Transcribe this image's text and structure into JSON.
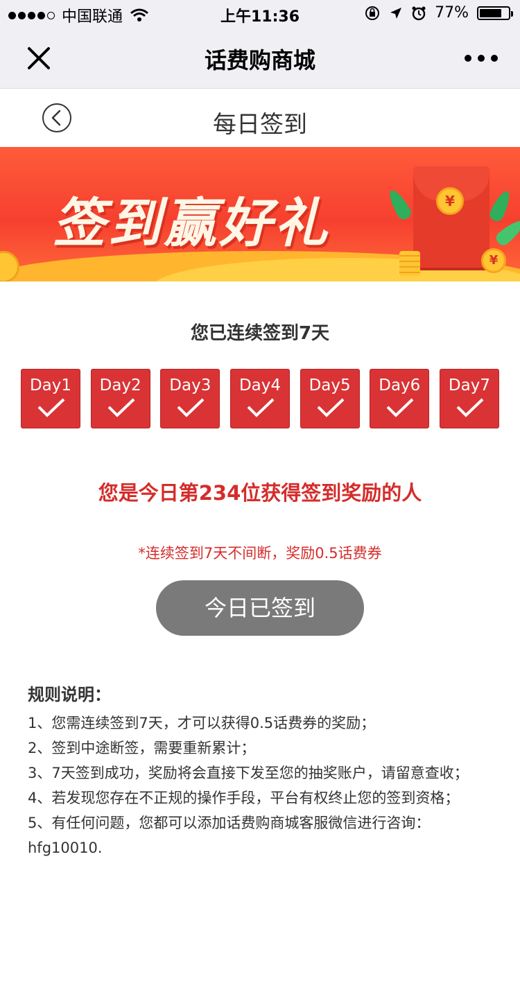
{
  "status_bar": {
    "carrier": "中国联通",
    "time": "上午11:36",
    "battery": "77%",
    "battery_level": 0.77
  },
  "nav": {
    "title": "话费购商城"
  },
  "page": {
    "title": "每日签到"
  },
  "banner": {
    "title": "签到赢好礼",
    "coin_symbol": "¥"
  },
  "streak": {
    "text": "您已连续签到7天",
    "days": [
      {
        "label": "Day1",
        "checked": true
      },
      {
        "label": "Day2",
        "checked": true
      },
      {
        "label": "Day3",
        "checked": true
      },
      {
        "label": "Day4",
        "checked": true
      },
      {
        "label": "Day5",
        "checked": true
      },
      {
        "label": "Day6",
        "checked": true
      },
      {
        "label": "Day7",
        "checked": true
      }
    ]
  },
  "rank_text": "您是今日第234位获得签到奖励的人",
  "note_text": "*连续签到7天不间断，奖励0.5话费券",
  "signed_button": "今日已签到",
  "rules": {
    "title": "规则说明：",
    "items": [
      "1、您需连续签到7天，才可以获得0.5话费券的奖励；",
      "2、签到中途断签，需要重新累计；",
      "3、7天签到成功，奖励将会直接下发至您的抽奖账户，请留意查收；",
      "4、若发现您存在不正规的操作手段，平台有权终止您的签到资格；",
      "5、有任何问题，您都可以添加话费购商城客服微信进行咨询：hfg10010."
    ]
  },
  "colors": {
    "accent_red": "#d93335",
    "text_red": "#d42d2b",
    "button_gray": "#7a7a7a",
    "nav_bg": "#efeff4"
  }
}
